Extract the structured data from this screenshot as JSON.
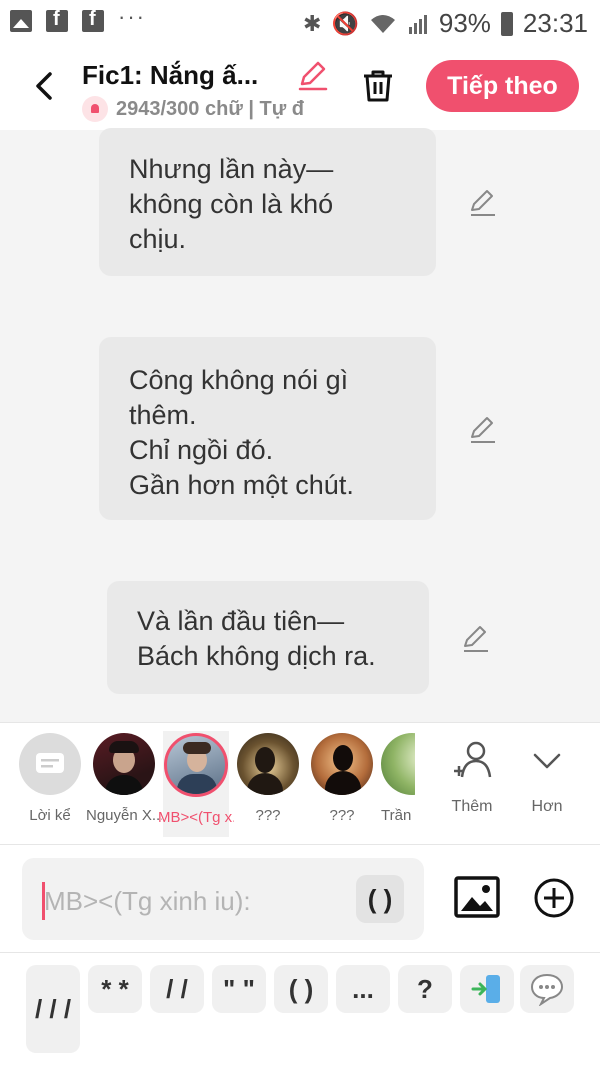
{
  "status_bar": {
    "icons_left": [
      "gallery-icon",
      "facebook-icon",
      "facebook-icon"
    ],
    "more": "···",
    "battery": "93%",
    "time": "23:31"
  },
  "header": {
    "title": "Fic1: Nắng ấ...",
    "subtitle": "2943/300 chữ | Tự đ",
    "next_label": "Tiếp theo"
  },
  "messages": [
    {
      "lines": [
        "Nhưng lần này—",
        "không còn là khó",
        "chịu."
      ]
    },
    {
      "lines": [
        "Công không nói gì",
        "thêm.",
        "Chỉ ngồi đó.",
        "Gần hơn một chút."
      ]
    },
    {
      "lines": [
        "Và lần đầu tiên—",
        "Bách không dịch ra."
      ]
    }
  ],
  "characters": [
    {
      "name": "Lời kể"
    },
    {
      "name": "Nguyễn X..."
    },
    {
      "name": "MB><(Tg x..."
    },
    {
      "name": "???"
    },
    {
      "name": "???"
    },
    {
      "name": "Trần T"
    }
  ],
  "side_buttons": {
    "add": "Thêm",
    "more": "Hơn"
  },
  "input": {
    "placeholder": "MB><(Tg xinh iu):",
    "paren": "( )"
  },
  "quick_keys": [
    "/ / /",
    "* *",
    "/ /",
    "\" \"",
    "( )",
    "...",
    "?"
  ],
  "colors": {
    "accent": "#f0506e",
    "bubble": "#e9e9e9",
    "background": "#f4f4f4"
  }
}
